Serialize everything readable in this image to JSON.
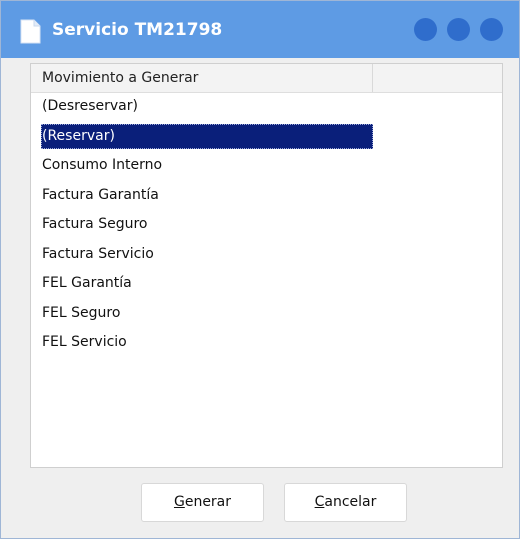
{
  "window": {
    "title": "Servicio TM21798",
    "colors": {
      "titlebar": "#5e9be4",
      "controls": "#2f6dcc",
      "selection": "#0a1f7a"
    },
    "controls": [
      "window-button-1",
      "window-button-2",
      "window-button-3"
    ]
  },
  "list": {
    "column_header": "Movimiento a Generar",
    "selected_index": 1,
    "items": [
      "(Desreservar)",
      "(Reservar)",
      "Consumo Interno",
      "Factura Garantía",
      "Factura Seguro",
      "Factura Servicio",
      "FEL Garantía",
      "FEL Seguro",
      "FEL Servicio"
    ]
  },
  "buttons": {
    "generate_mnemonic": "G",
    "generate_rest": "enerar",
    "cancel_mnemonic": "C",
    "cancel_rest": "ancelar"
  }
}
